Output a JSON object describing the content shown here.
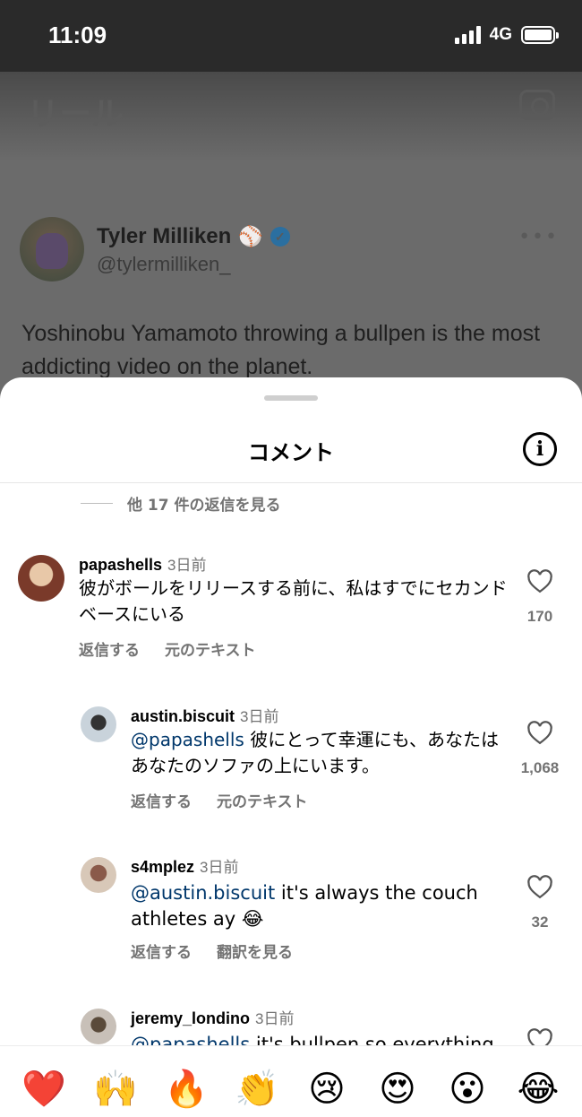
{
  "status": {
    "time": "11:09",
    "network": "4G"
  },
  "background": {
    "title": "リール",
    "tweet": {
      "name": "Tyler Milliken",
      "handle": "@tylermilliken_",
      "text": "Yoshinobu Yamamoto throwing a bullpen is the most addicting video on the planet."
    }
  },
  "sheet": {
    "title": "コメント",
    "view_replies": "他 17 件の返信を見る",
    "comments": [
      {
        "user": "papashells",
        "time": "3日前",
        "mention": "",
        "text": "彼がボールをリリースする前に、私はすでにセカンドベースにいる",
        "actions": [
          "返信する",
          "元のテキスト"
        ],
        "likes": "170"
      },
      {
        "user": "austin.biscuit",
        "time": "3日前",
        "mention": "@papashells",
        "text": "彼にとって幸運にも、あなたはあなたのソファの上にいます。",
        "actions": [
          "返信する",
          "元のテキスト"
        ],
        "likes": "1,068"
      },
      {
        "user": "s4mplez",
        "time": "3日前",
        "mention": "@austin.biscuit",
        "text": "it's always the couch athletes ay 😂",
        "actions": [
          "返信する",
          "翻訳を見る"
        ],
        "likes": "32"
      },
      {
        "user": "jeremy_londino",
        "time": "3日前",
        "mention": "@papashells",
        "text": "it's bullpen so everything",
        "actions": [],
        "likes": ""
      }
    ]
  },
  "emojis": [
    "❤️",
    "🙌",
    "🔥",
    "👏",
    "😢",
    "😍",
    "😮",
    "😂"
  ],
  "colors": {
    "mention": "#00376b",
    "muted": "#737373",
    "scrim": "#6b6b6b"
  }
}
